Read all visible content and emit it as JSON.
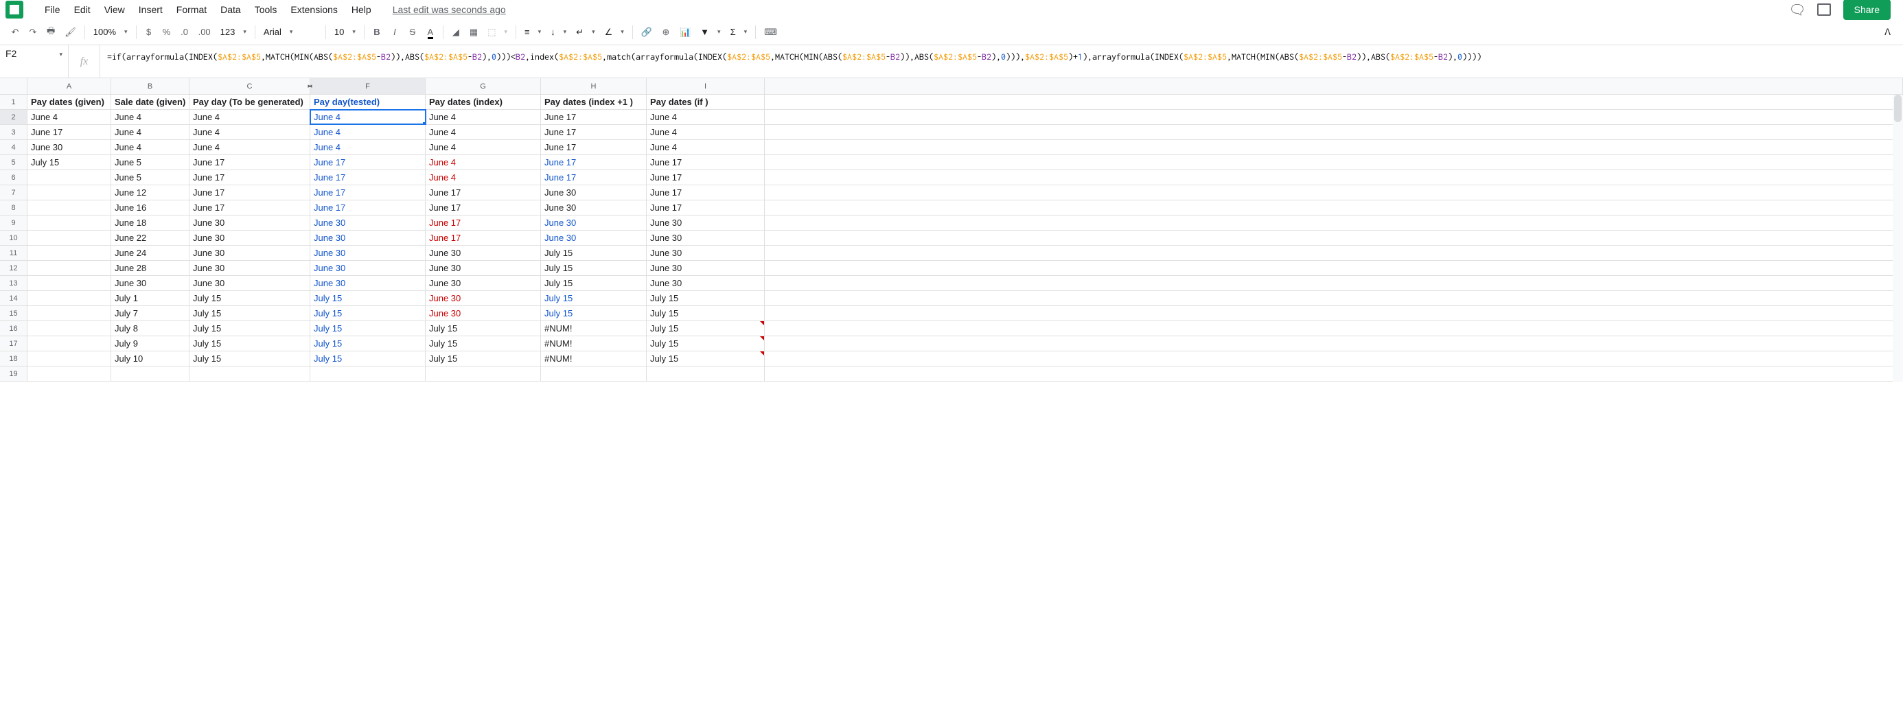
{
  "menu": {
    "items": [
      "File",
      "Edit",
      "View",
      "Insert",
      "Format",
      "Data",
      "Tools",
      "Extensions",
      "Help"
    ],
    "last_edit": "Last edit was seconds ago",
    "share": "Share"
  },
  "toolbar": {
    "zoom": "100%",
    "font": "Arial",
    "size": "10"
  },
  "namebox": "F2",
  "formula_parts": [
    {
      "t": "=if(arrayformula(INDEX(",
      "c": "fn"
    },
    {
      "t": "$A$2:$A$5",
      "c": "ref"
    },
    {
      "t": ",MATCH(MIN(ABS(",
      "c": "fn"
    },
    {
      "t": "$A$2:$A$5",
      "c": "ref"
    },
    {
      "t": "-",
      "c": "op"
    },
    {
      "t": "B2",
      "c": "refB"
    },
    {
      "t": ")),ABS(",
      "c": "fn"
    },
    {
      "t": "$A$2:$A$5",
      "c": "ref"
    },
    {
      "t": "-",
      "c": "op"
    },
    {
      "t": "B2",
      "c": "refB"
    },
    {
      "t": "),",
      "c": "fn"
    },
    {
      "t": "0",
      "c": "num"
    },
    {
      "t": ")))<",
      "c": "fn"
    },
    {
      "t": "B2",
      "c": "refB"
    },
    {
      "t": ",index(",
      "c": "fn"
    },
    {
      "t": "$A$2:$A$5",
      "c": "ref"
    },
    {
      "t": ",match(arrayformula(INDEX(",
      "c": "fn"
    },
    {
      "t": "$A$2:$A$5",
      "c": "ref"
    },
    {
      "t": ",MATCH(MIN(ABS(",
      "c": "fn"
    },
    {
      "t": "$A$2:$A$5",
      "c": "ref"
    },
    {
      "t": "-",
      "c": "op"
    },
    {
      "t": "B2",
      "c": "refB"
    },
    {
      "t": ")),ABS(",
      "c": "fn"
    },
    {
      "t": "$A$2:$A$5",
      "c": "ref"
    },
    {
      "t": "-",
      "c": "op"
    },
    {
      "t": "B2",
      "c": "refB"
    },
    {
      "t": "),",
      "c": "fn"
    },
    {
      "t": "0",
      "c": "num"
    },
    {
      "t": "))),",
      "c": "fn"
    },
    {
      "t": "$A$2:$A$5",
      "c": "ref"
    },
    {
      "t": ")+",
      "c": "fn"
    },
    {
      "t": "1",
      "c": "num"
    },
    {
      "t": "),arrayformula(INDEX(",
      "c": "fn"
    },
    {
      "t": "$A$2:$A$5",
      "c": "ref"
    },
    {
      "t": ",MATCH(MIN(ABS(",
      "c": "fn"
    },
    {
      "t": "$A$2:$A$5",
      "c": "ref"
    },
    {
      "t": "-",
      "c": "op"
    },
    {
      "t": "B2",
      "c": "refB"
    },
    {
      "t": ")),ABS(",
      "c": "fn"
    },
    {
      "t": "$A$2:$A$5",
      "c": "ref"
    },
    {
      "t": "-",
      "c": "op"
    },
    {
      "t": "B2",
      "c": "refB"
    },
    {
      "t": "),",
      "c": "fn"
    },
    {
      "t": "0",
      "c": "num"
    },
    {
      "t": "))))",
      "c": "fn"
    }
  ],
  "columns": [
    "A",
    "B",
    "C",
    "F",
    "G",
    "H",
    "I"
  ],
  "headers": {
    "A": "Pay dates (given)",
    "B": "Sale date (given)",
    "C": "Pay day (To be generated)",
    "F": "Pay day(tested)",
    "G": "Pay dates (index)",
    "H": "Pay dates (index +1 )",
    "I": "Pay dates (if )"
  },
  "rows": [
    {
      "n": 2,
      "A": "June 4",
      "B": "June 4",
      "C": "June 4",
      "F": "June 4",
      "G": "June 4",
      "H": "June 17",
      "I": "June 4"
    },
    {
      "n": 3,
      "A": "June 17",
      "B": "June 4",
      "C": "June 4",
      "F": "June 4",
      "G": "June 4",
      "H": "June 17",
      "I": "June 4"
    },
    {
      "n": 4,
      "A": "June 30",
      "B": "June 4",
      "C": "June 4",
      "F": "June 4",
      "G": "June 4",
      "H": "June 17",
      "I": "June 4"
    },
    {
      "n": 5,
      "A": "July 15",
      "B": "June 5",
      "C": "June 17",
      "F": "June 17",
      "G": "June 4",
      "Gc": "red",
      "H": "June 17",
      "Hc": "blue",
      "I": "June 17"
    },
    {
      "n": 6,
      "B": "June 5",
      "C": "June 17",
      "F": "June 17",
      "G": "June 4",
      "Gc": "red",
      "H": "June 17",
      "Hc": "blue",
      "I": "June 17"
    },
    {
      "n": 7,
      "B": "June 12",
      "C": "June 17",
      "F": "June 17",
      "G": "June 17",
      "H": "June 30",
      "I": "June 17"
    },
    {
      "n": 8,
      "B": "June 16",
      "C": "June 17",
      "F": "June 17",
      "G": "June 17",
      "H": "June 30",
      "I": "June 17"
    },
    {
      "n": 9,
      "B": "June 18",
      "C": "June 30",
      "F": "June 30",
      "G": "June 17",
      "Gc": "red",
      "H": "June 30",
      "Hc": "blue",
      "I": "June 30"
    },
    {
      "n": 10,
      "B": "June 22",
      "C": "June 30",
      "F": "June 30",
      "G": "June 17",
      "Gc": "red",
      "H": "June 30",
      "Hc": "blue",
      "I": "June 30"
    },
    {
      "n": 11,
      "B": "June 24",
      "C": "June 30",
      "F": "June 30",
      "G": "June 30",
      "H": "July 15",
      "I": "June 30"
    },
    {
      "n": 12,
      "B": "June 28",
      "C": "June 30",
      "F": "June 30",
      "G": "June 30",
      "H": "July 15",
      "I": "June 30"
    },
    {
      "n": 13,
      "B": "June 30",
      "C": "June 30",
      "F": "June 30",
      "G": "June 30",
      "H": "July 15",
      "I": "June 30"
    },
    {
      "n": 14,
      "B": "July 1",
      "C": "July 15",
      "F": "July 15",
      "G": "June 30",
      "Gc": "red",
      "H": "July 15",
      "Hc": "blue",
      "I": "July 15"
    },
    {
      "n": 15,
      "B": "July 7",
      "C": "July 15",
      "F": "July 15",
      "G": "June 30",
      "Gc": "red",
      "H": "July 15",
      "Hc": "blue",
      "I": "July 15"
    },
    {
      "n": 16,
      "B": "July 8",
      "C": "July 15",
      "F": "July 15",
      "G": "July 15",
      "H": "#NUM!",
      "I": "July 15",
      "Ierr": true
    },
    {
      "n": 17,
      "B": "July 9",
      "C": "July 15",
      "F": "July 15",
      "G": "July 15",
      "H": "#NUM!",
      "I": "July 15",
      "Ierr": true
    },
    {
      "n": 18,
      "B": "July 10",
      "C": "July 15",
      "F": "July 15",
      "G": "July 15",
      "H": "#NUM!",
      "I": "July 15",
      "Ierr": true
    },
    {
      "n": 19
    }
  ],
  "selected": {
    "row": 2,
    "col": "F"
  }
}
